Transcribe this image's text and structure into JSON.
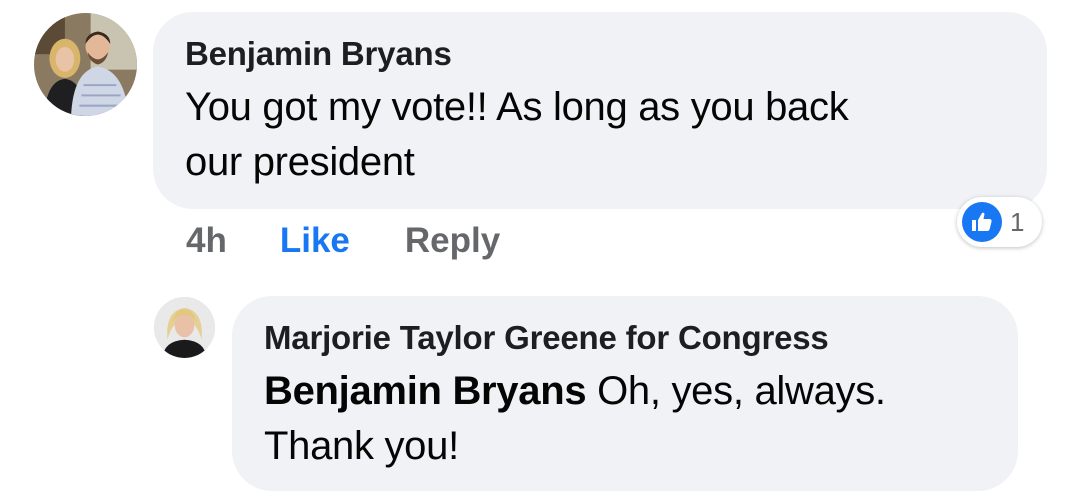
{
  "comment": {
    "author": "Benjamin Bryans",
    "text_line1": "You got my vote!! As long as you back",
    "text_line2": "our president",
    "time": "4h",
    "like_label": "Like",
    "reply_label": "Reply",
    "reaction_count": "1",
    "reaction_icon": "thumbs-up-icon"
  },
  "reply": {
    "author": "Marjorie Taylor Greene for Congress",
    "tagged_user": "Benjamin Bryans",
    "text_line1_rest": " Oh, yes, always.",
    "text_line2": "Thank you!"
  },
  "colors": {
    "bubble": "#f0f2f5",
    "like_blue": "#1877f2",
    "secondary_text": "#65676b"
  }
}
